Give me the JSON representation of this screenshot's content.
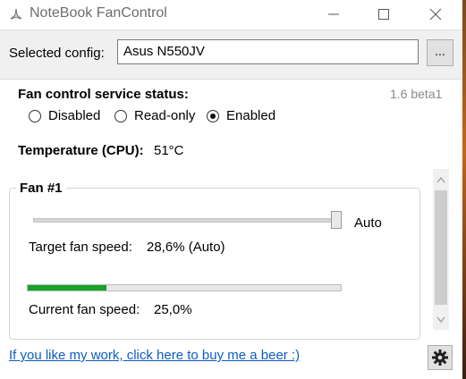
{
  "window": {
    "title": "NoteBook FanControl",
    "icons": [
      "fan-app-icon",
      "minimize-icon",
      "maximize-icon",
      "close-icon"
    ]
  },
  "config": {
    "label": "Selected config:",
    "value": "Asus N550JV",
    "browse_label": "..."
  },
  "service": {
    "title": "Fan control service status:",
    "version": "1.6 beta1",
    "options": [
      {
        "label": "Disabled",
        "checked": false
      },
      {
        "label": "Read-only",
        "checked": false
      },
      {
        "label": "Enabled",
        "checked": true
      }
    ]
  },
  "temperature": {
    "label": "Temperature (CPU):",
    "value": "51°C"
  },
  "fan": {
    "title": "Fan #1",
    "slider_label": "Auto",
    "slider_level": 1.0,
    "target_label": "Target fan speed:",
    "target_value": "28,6% (Auto)",
    "current_label": "Current fan speed:",
    "current_value": "25,0%",
    "current_percent": 25.0
  },
  "footer": {
    "link_text": "If you like my work, click here to buy me a beer :)",
    "settings_icon": "gear-icon"
  },
  "colors": {
    "progress_fill": "#16a229",
    "link": "#0b5cc2"
  }
}
